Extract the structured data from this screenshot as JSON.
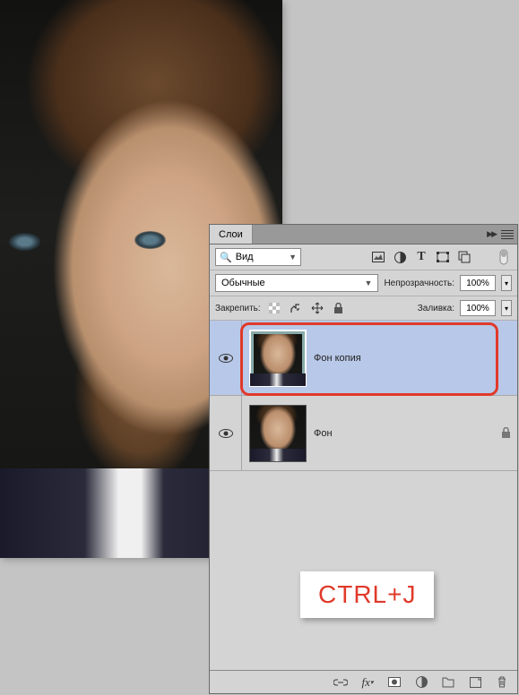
{
  "panel": {
    "tab_label": "Слои",
    "filter_label": "Вид",
    "blend_mode": "Обычные",
    "opacity_label": "Непрозрачность:",
    "opacity_value": "100%",
    "fill_label": "Заливка:",
    "fill_value": "100%",
    "lock_label": "Закрепить:"
  },
  "layers": [
    {
      "name": "Фон копия",
      "selected": true,
      "locked": false
    },
    {
      "name": "Фон",
      "selected": false,
      "locked": true
    }
  ],
  "shortcut": "CTRL+J",
  "icons": {
    "search": "🔍",
    "image": "▢",
    "adjust": "◐",
    "type": "T",
    "vector": "▭",
    "smart": "☐",
    "lock": "🔒",
    "link": "⧉",
    "pin": "✚",
    "move": "✥"
  }
}
